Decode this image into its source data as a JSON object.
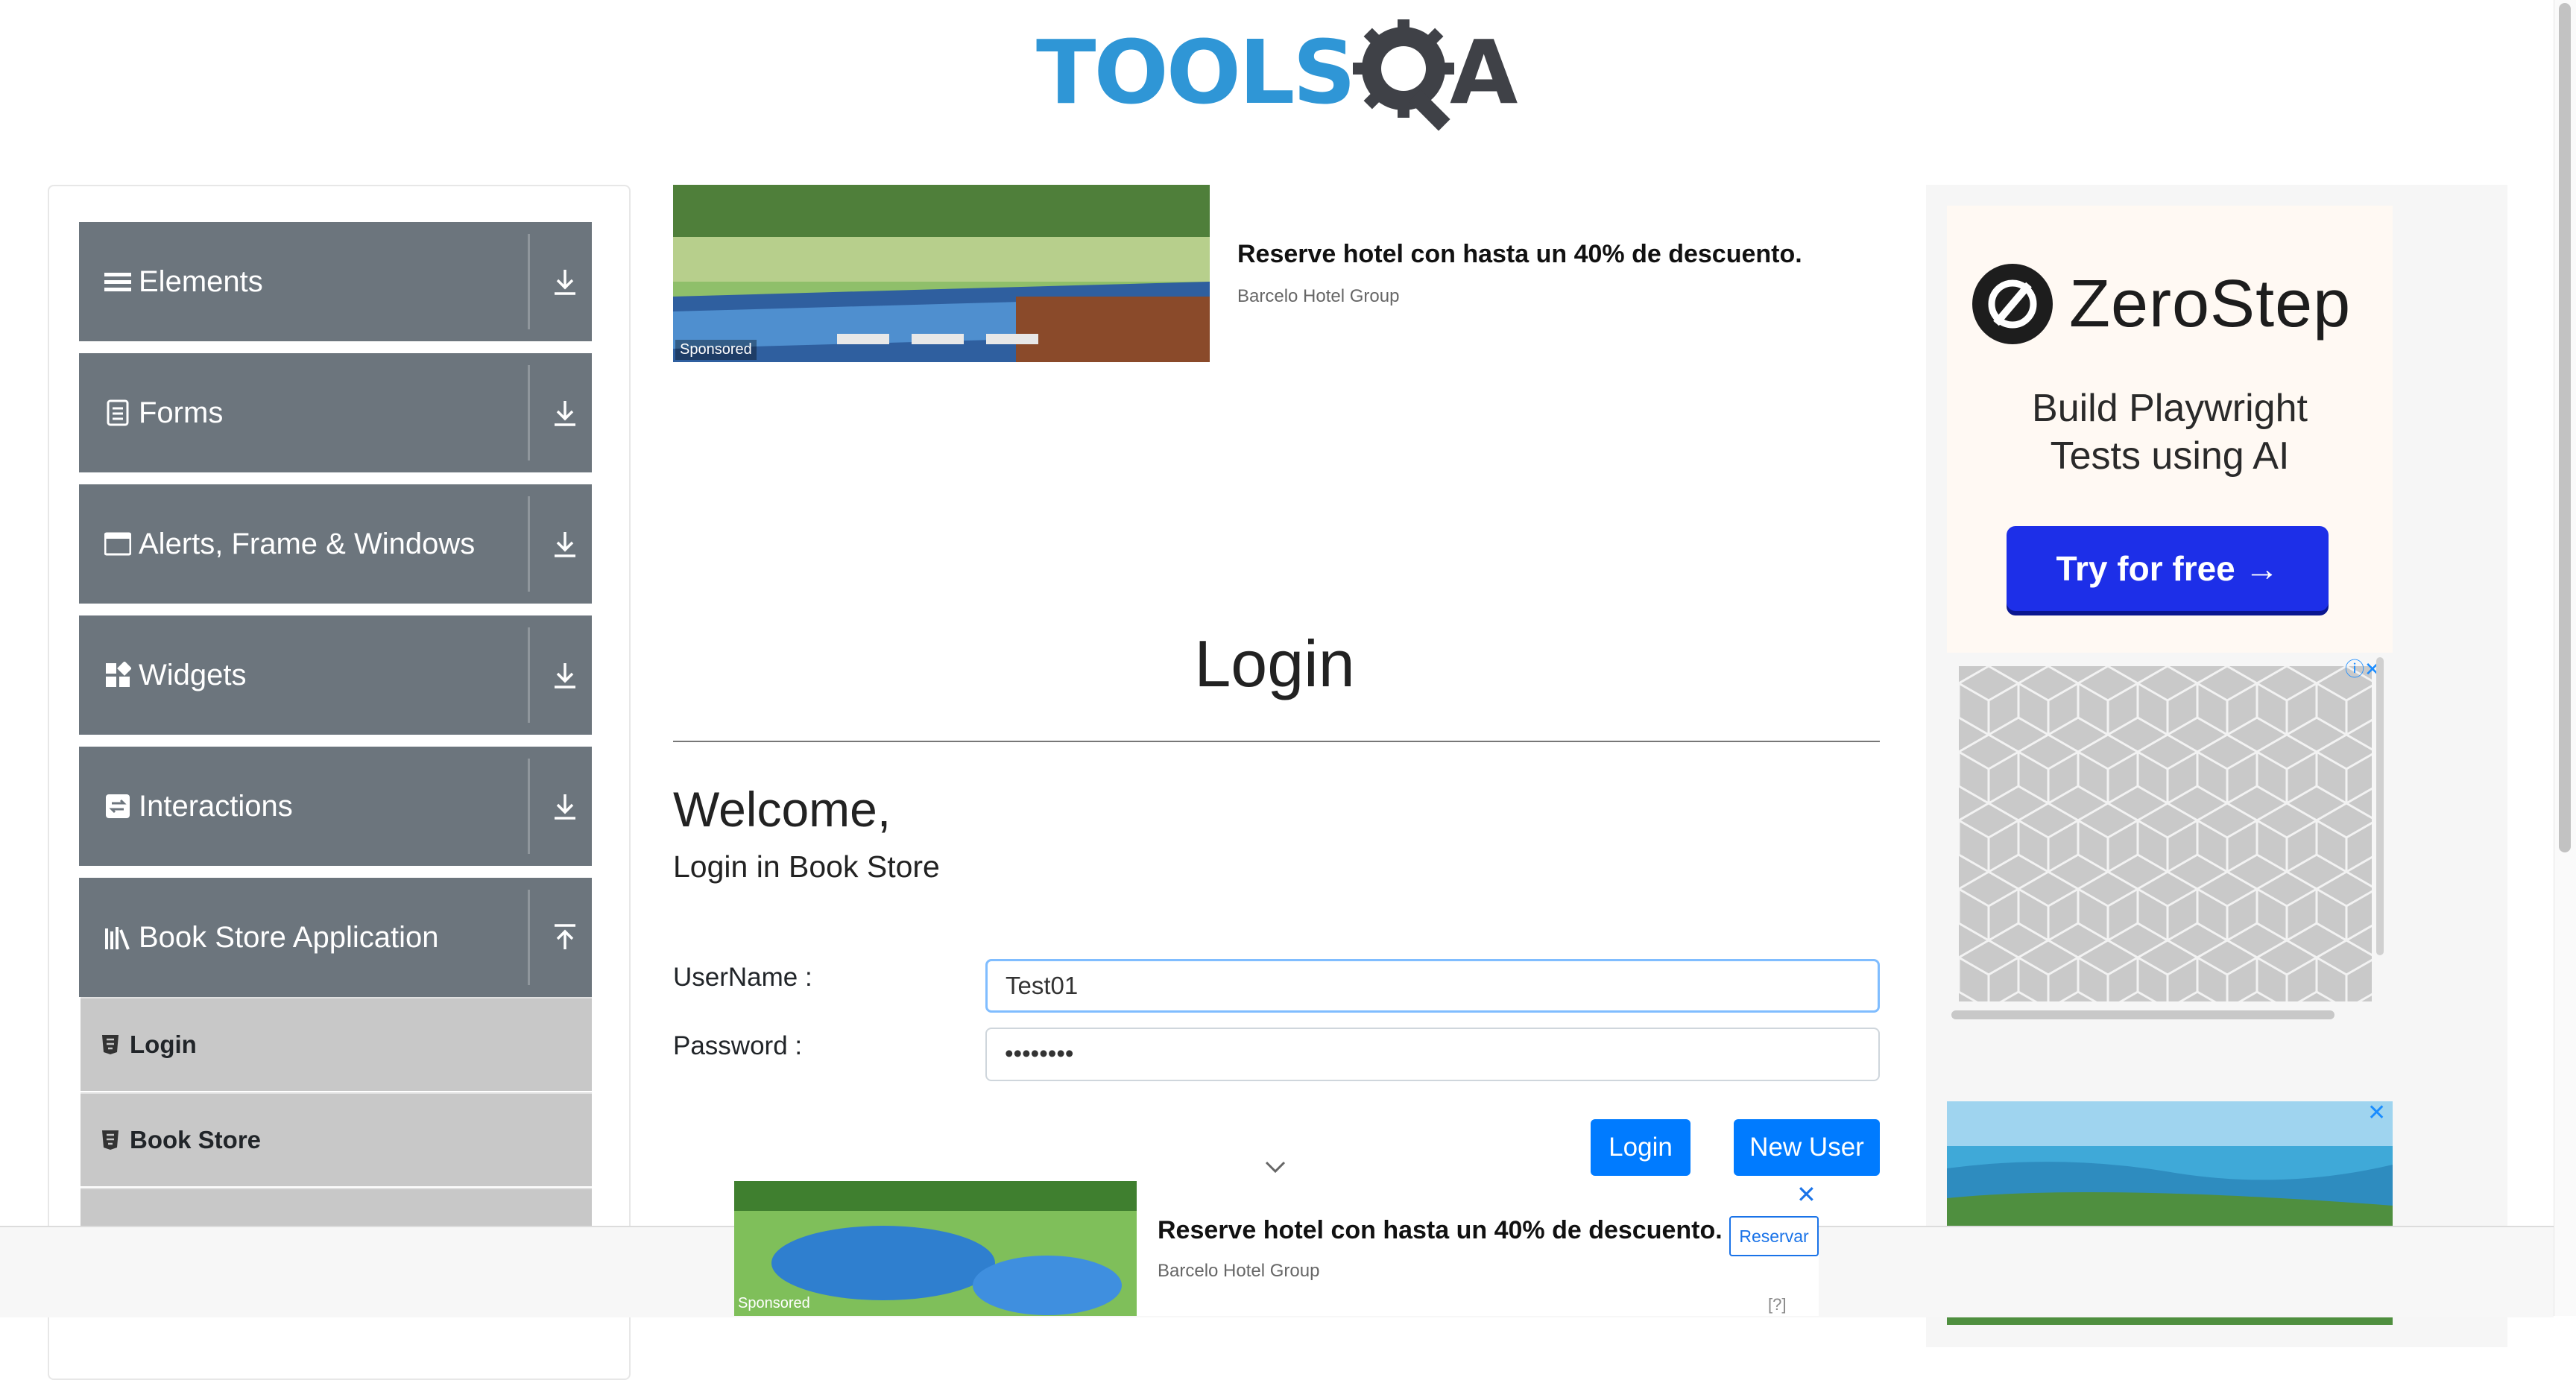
{
  "header": {
    "logo_text": "TOOLS",
    "logo_suffix": "A"
  },
  "sidebar": {
    "groups": [
      {
        "label": "Elements",
        "icon": "hamburger-icon"
      },
      {
        "label": "Forms",
        "icon": "document-icon"
      },
      {
        "label": "Alerts, Frame & Windows",
        "icon": "window-icon"
      },
      {
        "label": "Widgets",
        "icon": "widgets-icon"
      },
      {
        "label": "Interactions",
        "icon": "interactions-icon"
      },
      {
        "label": "Book Store Application",
        "icon": "books-icon"
      }
    ],
    "subitems": [
      {
        "label": "Login",
        "icon": "html-icon"
      },
      {
        "label": "Book Store",
        "icon": "html-icon"
      }
    ]
  },
  "top_ad": {
    "sponsored": "Sponsored",
    "title": "Reserve hotel con hasta un 40% de descuento.",
    "brand": "Barcelo Hotel Group"
  },
  "main": {
    "header": "Login",
    "welcome": "Welcome,",
    "subtitle": "Login in Book Store",
    "username_label": "UserName :",
    "username_value": "Test01",
    "password_label": "Password :",
    "password_value": "••••••••",
    "login_button": "Login",
    "new_user_button": "New User"
  },
  "right_ads": {
    "zerostep_name": "ZeroStep",
    "zerostep_tagline_1": "Build Playwright",
    "zerostep_tagline_2": "Tests using AI",
    "zerostep_cta": "Try for free →",
    "info_close": "ⓘ✕",
    "close": "✕"
  },
  "bottom_ad": {
    "sponsored": "Sponsored",
    "title": "Reserve hotel con hasta un 40% de descuento.",
    "brand": "Barcelo Hotel Group",
    "cta": "Reservar",
    "close": "✕",
    "help": "[?]"
  },
  "colors": {
    "sidebar_group": "#6c757d",
    "sidebar_subitem": "#c8c8c8",
    "primary": "#007bff",
    "logo_blue": "#2f96d6",
    "zerostep_blue": "#1d2fe8"
  }
}
